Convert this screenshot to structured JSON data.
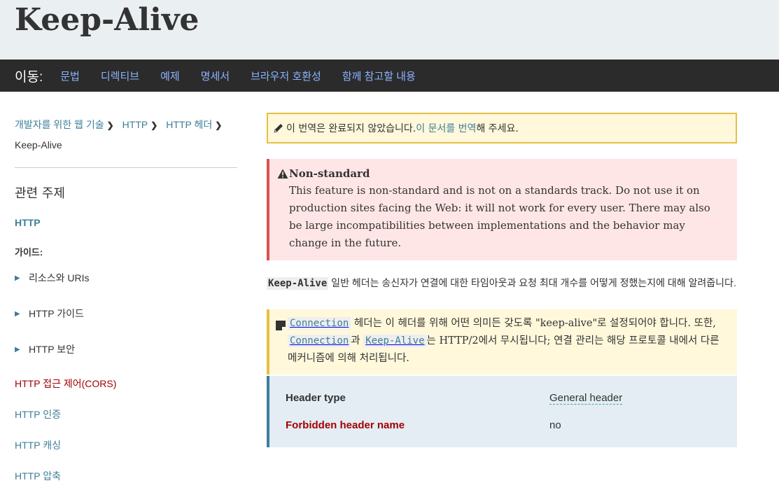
{
  "page": {
    "title": "Keep-Alive"
  },
  "jump": {
    "label": "이동:",
    "links": [
      "문법",
      "디렉티브",
      "예제",
      "명세서",
      "브라우저 호환성",
      "함께 참고할 내용"
    ]
  },
  "breadcrumb": {
    "items": [
      "개발자를 위한 웹 기술",
      "HTTP",
      "HTTP 헤더"
    ],
    "current": "Keep-Alive"
  },
  "sidebar": {
    "related_title": "관련 주제",
    "http_link": "HTTP",
    "guides_label": "가이드:",
    "guide_items": [
      "리소스와 URIs",
      "HTTP 가이드",
      "HTTP 보안"
    ],
    "links": [
      "HTTP 접근 제어(CORS)",
      "HTTP 인증",
      "HTTP 캐싱",
      "HTTP 압축"
    ]
  },
  "notice": {
    "text_before": "이 번역은 완료되지 않았습니다. ",
    "link": "이 문서를 번역",
    "text_after": "해 주세요."
  },
  "nonstandard": {
    "title": "Non-standard",
    "body": "This feature is non-standard and is not on a standards track. Do not use it on production sites facing the Web: it will not work for every user. There may also be large incompatibilities between implementations and the behavior may change in the future."
  },
  "description": {
    "code": "Keep-Alive",
    "text": " 일반 헤더는 송신자가 연결에 대한 타임아웃과 요청 최대 개수를 어떻게 정했는지에 대해 알려줍니다."
  },
  "note": {
    "code1": "Connection",
    "text1": " 헤더는 이 헤더를 위해 어떤 의미든 갖도록 \"keep-alive\"로 설정되어야 합니다. 또한, ",
    "code2": "Connection",
    "text2": "과 ",
    "code3": "Keep-Alive",
    "text3": "는 HTTP/2에서 무시됩니다; 연결 관리는 해당 프로토콜 내에서 다른 메커니즘에 의해 처리됩니다."
  },
  "properties": {
    "header_type_label": "Header type",
    "header_type_value": "General header",
    "forbidden_label": "Forbidden header name",
    "forbidden_value": "no"
  },
  "icons": {
    "notice": "pencil-icon",
    "nonstandard": "warning-icon",
    "note": "note-icon",
    "guide_item": "triangle-right-icon"
  },
  "colors": {
    "link": "#3d7e9a",
    "nav_link": "#8cb4ff",
    "cors": "#a40000",
    "warning_border": "#d9534f",
    "warning_bg": "#ffe6e6",
    "note_bg": "#fff8db",
    "note_border": "#e5c043",
    "props_bg": "#e3edf3"
  }
}
